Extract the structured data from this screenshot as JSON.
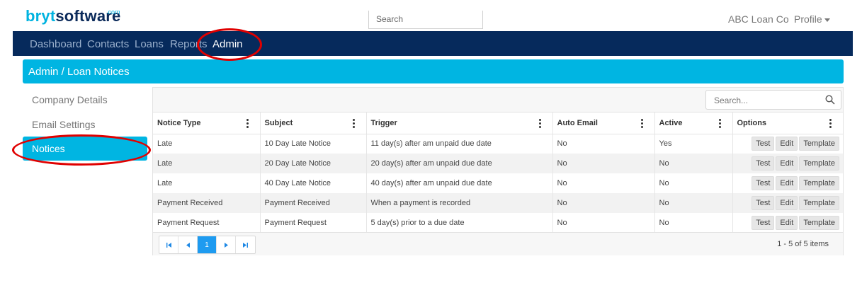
{
  "brand": {
    "part1": "bryt",
    "part2": "software",
    "suffix": ".com"
  },
  "header": {
    "search_placeholder": "Search",
    "company": "ABC Loan Co",
    "profile_label": "Profile"
  },
  "nav": {
    "items": [
      "Dashboard",
      "Contacts",
      "Loans",
      "Reports",
      "Admin"
    ],
    "active": "Admin"
  },
  "breadcrumb": "Admin / Loan Notices",
  "sidebar": {
    "items": [
      "Company Details",
      "Email Settings",
      "Notices"
    ],
    "active": "Notices"
  },
  "grid": {
    "search_placeholder": "Search...",
    "columns": [
      "Notice Type",
      "Subject",
      "Trigger",
      "Auto Email",
      "Active",
      "Options"
    ],
    "rows": [
      [
        "Late",
        "10 Day Late Notice",
        "11 day(s) after am unpaid due date",
        "No",
        "Yes"
      ],
      [
        "Late",
        "20 Day Late Notice",
        "20 day(s) after am unpaid due date",
        "No",
        "No"
      ],
      [
        "Late",
        "40 Day Late Notice",
        "40 day(s) after am unpaid due date",
        "No",
        "No"
      ],
      [
        "Payment Received",
        "Payment Received",
        "When a payment is recorded",
        "No",
        "No"
      ],
      [
        "Payment Request",
        "Payment Request",
        "5 day(s) prior to a due date",
        "No",
        "No"
      ]
    ],
    "row_actions": [
      "Test",
      "Edit",
      "Template"
    ],
    "pager": {
      "current_page": "1",
      "info": "1 - 5 of 5 items"
    }
  },
  "colors": {
    "brand_cyan": "#00b5e2",
    "navy": "#062a5c",
    "annotation_red": "#e00000",
    "pager_blue": "#1e9bf0"
  },
  "icons": [
    "search-icon",
    "kebab-menu-icon",
    "first-page-icon",
    "prev-page-icon",
    "next-page-icon",
    "last-page-icon",
    "caret-down-icon"
  ]
}
